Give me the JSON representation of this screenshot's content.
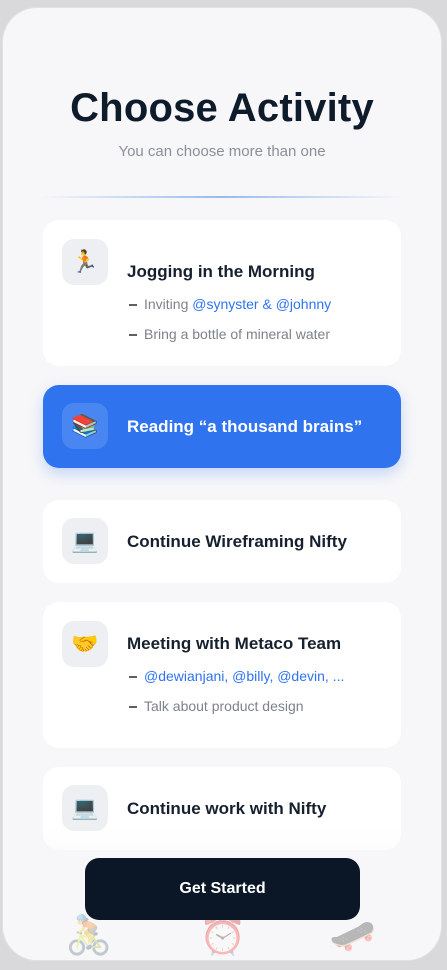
{
  "header": {
    "title": "Choose Activity",
    "subtitle": "You can choose more than one"
  },
  "activities": [
    {
      "title": "Jogging in the Morning",
      "icon": "🏃",
      "icon_name": "runner-icon",
      "selected": false,
      "lines": [
        {
          "prefix": "Inviting ",
          "mention": "@synyster & @johnny"
        },
        {
          "text": "Bring a bottle of mineral water"
        }
      ]
    },
    {
      "title": "Reading “a thousand brains”",
      "icon": "📚",
      "icon_name": "books-icon",
      "selected": true
    },
    {
      "title": "Continue Wireframing Nifty",
      "icon": "💻",
      "icon_name": "laptop-icon",
      "selected": false
    },
    {
      "title": "Meeting with Metaco Team",
      "icon": "🤝",
      "icon_name": "handshake-icon",
      "selected": false,
      "lines": [
        {
          "mention": "@dewianjani, @billy, @devin, ..."
        },
        {
          "text": "Talk about product design"
        }
      ]
    },
    {
      "title": "Continue work with Nifty",
      "icon": "💻",
      "icon_name": "laptop-icon",
      "selected": false
    }
  ],
  "cta": {
    "label": "Get Started"
  },
  "colors": {
    "accent": "#2f73ee",
    "dark": "#0b1626"
  },
  "decorations": [
    {
      "glyph": "🚴",
      "name": "cyclist-icon"
    },
    {
      "glyph": "⏰",
      "name": "alarm-clock-icon"
    },
    {
      "glyph": "🛹",
      "name": "skateboard-icon"
    }
  ]
}
